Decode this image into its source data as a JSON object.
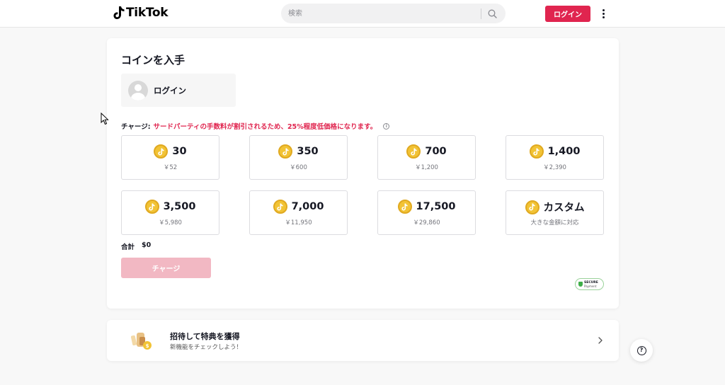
{
  "header": {
    "logo_text": "TikTok",
    "search_placeholder": "検索",
    "login_label": "ログイン",
    "accent_color": "#e0254f"
  },
  "coins": {
    "title": "コインを入手",
    "account_label": "ログイン",
    "charge_label": "チャージ:",
    "charge_warning": "サードパーティの手数料が割引されるため、25%程度低価格になります。",
    "packages": [
      {
        "amount": "30",
        "price": "￥52"
      },
      {
        "amount": "350",
        "price": "￥600"
      },
      {
        "amount": "700",
        "price": "￥1,200"
      },
      {
        "amount": "1,400",
        "price": "￥2,390"
      },
      {
        "amount": "3,500",
        "price": "￥5,980"
      },
      {
        "amount": "7,000",
        "price": "￥11,950"
      },
      {
        "amount": "17,500",
        "price": "￥29,860"
      },
      {
        "amount": "カスタム",
        "price": "大きな金額に対応"
      }
    ],
    "total_label": "合計",
    "total_value": "$0",
    "charge_button": "チャージ",
    "secure_line1": "SECURE",
    "secure_line2": "Payment"
  },
  "invite": {
    "title": "招待して特典を獲得",
    "subtitle": "新機能をチェックしよう！"
  },
  "help": {
    "icon_glyph": "?"
  }
}
